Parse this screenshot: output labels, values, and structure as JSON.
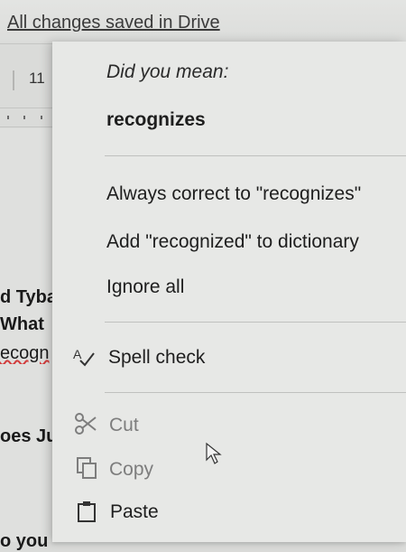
{
  "document": {
    "save_status": "All changes saved in Drive",
    "font_size": "11",
    "lines": [
      "d Tyba",
      "What",
      "ecogn",
      "oes Ju",
      "o you"
    ],
    "right_fragment": "("
  },
  "context_menu": {
    "hint": "Did you mean:",
    "suggestion": "recognizes",
    "always_correct": "Always correct to \"recognizes\"",
    "add_to_dictionary": "Add \"recognized\" to dictionary",
    "ignore_all": "Ignore all",
    "spell_check": "Spell check",
    "cut": "Cut",
    "copy": "Copy",
    "paste": "Paste"
  },
  "icons": {
    "spell_check": "spellcheck-icon",
    "cut": "scissors-icon",
    "copy": "copy-icon",
    "paste": "paste-icon",
    "pointer": "mouse-pointer-icon"
  },
  "colors": {
    "misspelling_underline": "#d23c3c",
    "menu_background": "#e7e8e6",
    "disabled_text": "#7d7d7d"
  }
}
